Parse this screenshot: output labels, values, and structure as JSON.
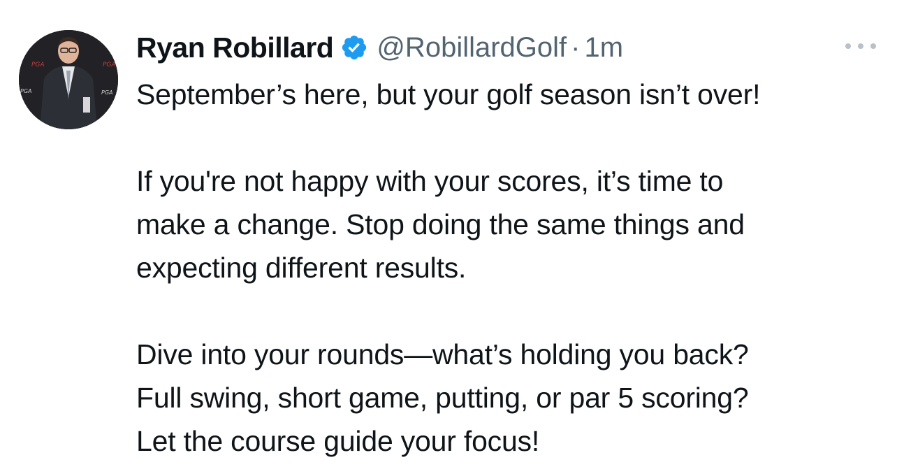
{
  "tweet": {
    "author": {
      "display_name": "Ryan Robillard",
      "handle": "@RobillardGolf",
      "verified": true,
      "verified_color": "#1d9bf0"
    },
    "separator": "·",
    "timestamp": "1m",
    "more_icon": "more-horizontal-icon",
    "paragraphs": [
      [
        "September’s here, but your golf season isn’t over!"
      ],
      [
        "If you're not happy with your scores, it’s time to",
        "make a change. Stop doing the same things and",
        "expecting different results."
      ],
      [
        "Dive into your rounds—what’s holding you back?",
        "Full swing, short game, putting, or par 5 scoring?",
        "Let the course guide your focus!"
      ]
    ]
  },
  "colors": {
    "text": "#0f1419",
    "secondary": "#536471",
    "dots": "#b9c1c8"
  }
}
